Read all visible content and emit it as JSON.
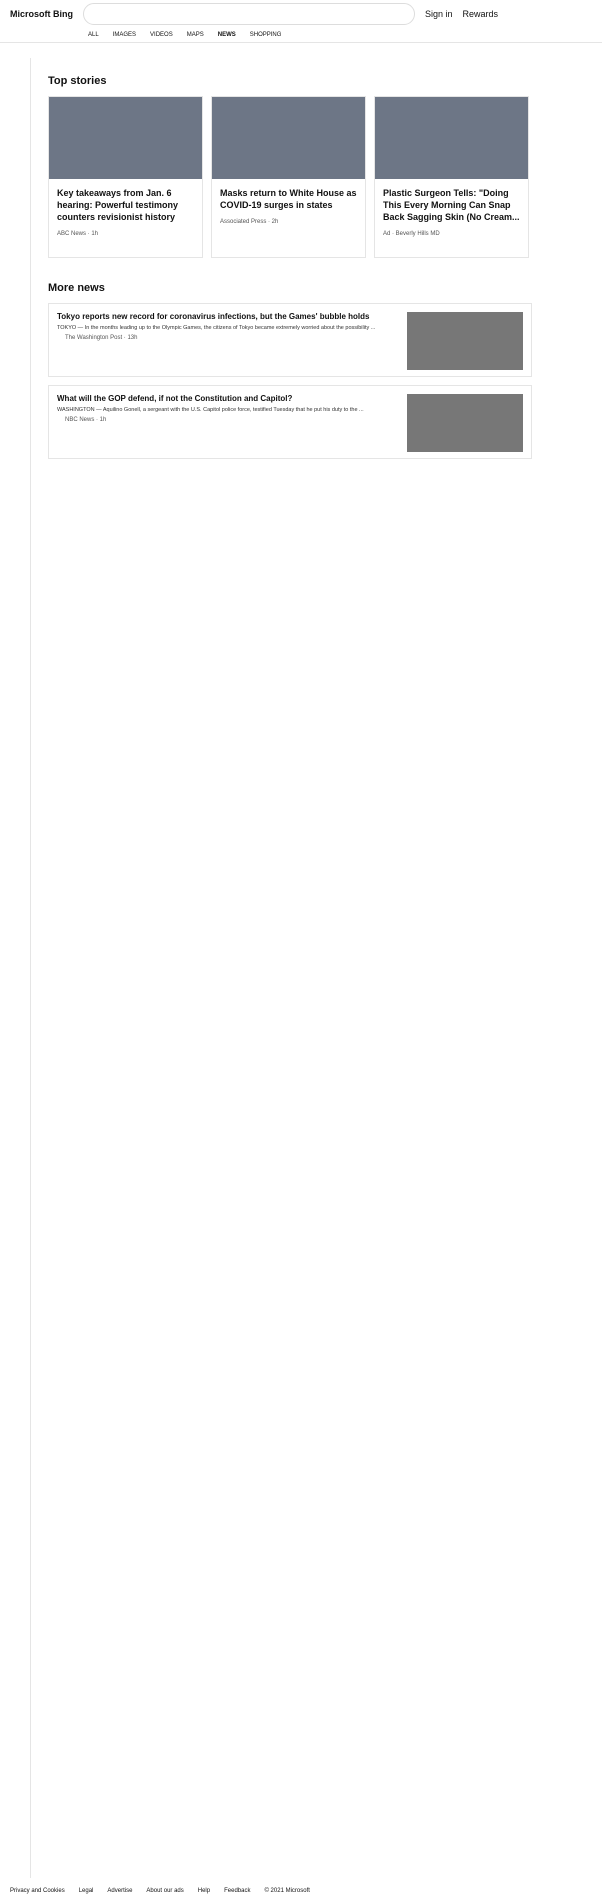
{
  "logo": "Microsoft Bing",
  "sign": "Sign in",
  "rewards": "Rewards",
  "tabs": [
    "ALL",
    "IMAGES",
    "VIDEOS",
    "MAPS",
    "NEWS",
    "SHOPPING"
  ],
  "top": "Top stories",
  "cards": [
    {
      "t": "Key takeaways from Jan. 6 hearing: Powerful testimony counters revisionist history",
      "s": "ABC News · 1h"
    },
    {
      "t": "Masks return to White House as COVID-19 surges in states",
      "s": "Associated Press · 2h"
    },
    {
      "t": "Plastic Surgeon Tells: \"Doing This Every Morning Can Snap Back Sagging Skin (No Cream...",
      "s": "Ad · Beverly Hills MD"
    }
  ],
  "more": "More news",
  "news": [
    {
      "t": "Tokyo reports new record for coronavirus infections, but the Games' bubble holds",
      "d": "TOKYO — In the months leading up to the Olympic Games, the citizens of Tokyo became extremely worried about the possibility ...",
      "s": "The Washington Post · 13h"
    },
    {
      "t": "What will the GOP defend, if not the Constitution and Capitol?",
      "d": "WASHINGTON — Aquilino Gonell, a sergeant with the U.S. Capitol police force, testified Tuesday that he put his duty to the ...",
      "s": "NBC News · 1h"
    }
  ],
  "footer": [
    "Privacy and Cookies",
    "Legal",
    "Advertise",
    "About our ads",
    "Help",
    "Feedback",
    "© 2021 Microsoft"
  ]
}
